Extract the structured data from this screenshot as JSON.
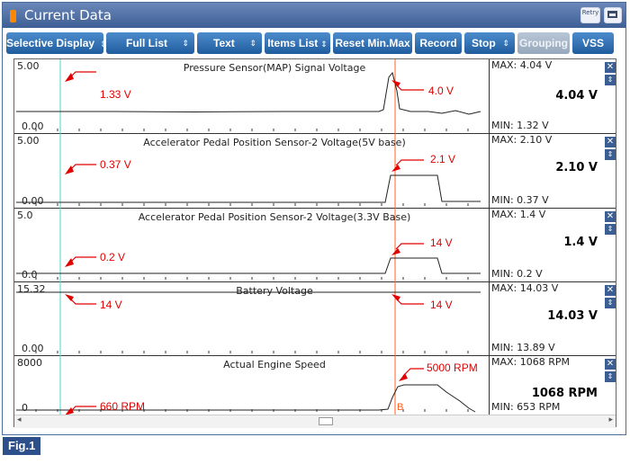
{
  "window": {
    "title": "Current Data",
    "retry_label": "Retry"
  },
  "toolbar": {
    "selective_display": "Selective Display",
    "full_list": "Full List",
    "text": "Text",
    "items_list": "Items List",
    "reset_min_max": "Reset Min.Max",
    "record": "Record",
    "stop": "Stop",
    "grouping": "Grouping",
    "vss": "VSS",
    "arrow_glyph": "⇕"
  },
  "panels": [
    {
      "title": "Pressure Sensor(MAP) Signal Voltage",
      "scale_top": "5.00",
      "scale_bottom": "0.00",
      "max": "MAX:  4.04 V",
      "min": "MIN:  1.32 V",
      "current": "4.04 V",
      "annot_left": "1.33 V",
      "annot_right": "4.0 V"
    },
    {
      "title": "Accelerator Pedal Position Sensor-2 Voltage(5V base)",
      "scale_top": "5.00",
      "scale_bottom": "0.00",
      "max": "MAX:  2.10 V",
      "min": "MIN:  0.37 V",
      "current": "2.10 V",
      "annot_left": "0.37 V",
      "annot_right": "2.1 V"
    },
    {
      "title": "Accelerator Pedal Position Sensor-2 Voltage(3.3V Base)",
      "scale_top": "5.0",
      "scale_bottom": "0.0",
      "max": "MAX:    1.4 V",
      "min": "MIN:    0.2 V",
      "current": "1.4 V",
      "annot_left": "0.2 V",
      "annot_right": "14 V"
    },
    {
      "title": "Battery Voltage",
      "scale_top": "15.32",
      "scale_bottom": "0.00",
      "max": "MAX: 14.03 V",
      "min": "MIN: 13.89 V",
      "current": "14.03 V",
      "annot_left": "14 V",
      "annot_right": "14 V"
    },
    {
      "title": "Actual Engine Speed",
      "scale_top": "8000",
      "scale_bottom": "0",
      "max": "MAX:   1068 RPM",
      "min": "MIN:    653 RPM",
      "current": "1068 RPM",
      "annot_left": "660 RPM",
      "annot_right": "5000 RPM"
    }
  ],
  "marker_label": "B",
  "figure_label": "Fig.1"
}
